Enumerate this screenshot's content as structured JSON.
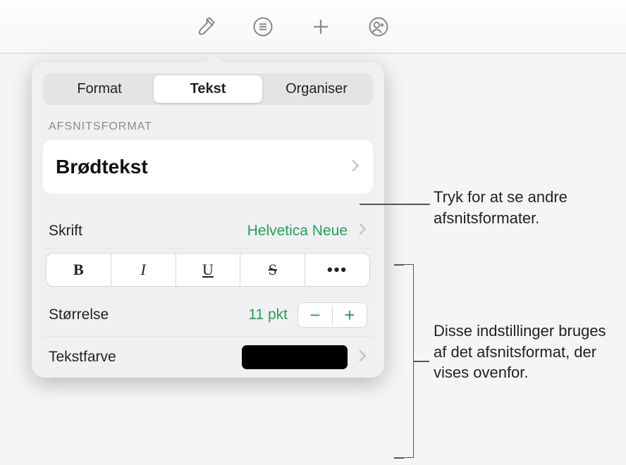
{
  "tabs": {
    "format": "Format",
    "text": "Tekst",
    "organize": "Organiser"
  },
  "section_label": "AFSNITSFORMAT",
  "paragraph_style": "Brødtekst",
  "font": {
    "label": "Skrift",
    "value": "Helvetica Neue"
  },
  "style_buttons": {
    "bold": "B",
    "italic": "I",
    "underline": "U",
    "strike": "S",
    "more": "•••"
  },
  "size": {
    "label": "Størrelse",
    "value": "11 pkt",
    "minus": "−",
    "plus": "+"
  },
  "text_color": {
    "label": "Tekstfarve",
    "value": "#000000"
  },
  "annotations": {
    "a1": "Tryk for at se andre afsnitsformater.",
    "a2": "Disse indstillinger bruges af det afsnitsformat, der vises ovenfor."
  }
}
